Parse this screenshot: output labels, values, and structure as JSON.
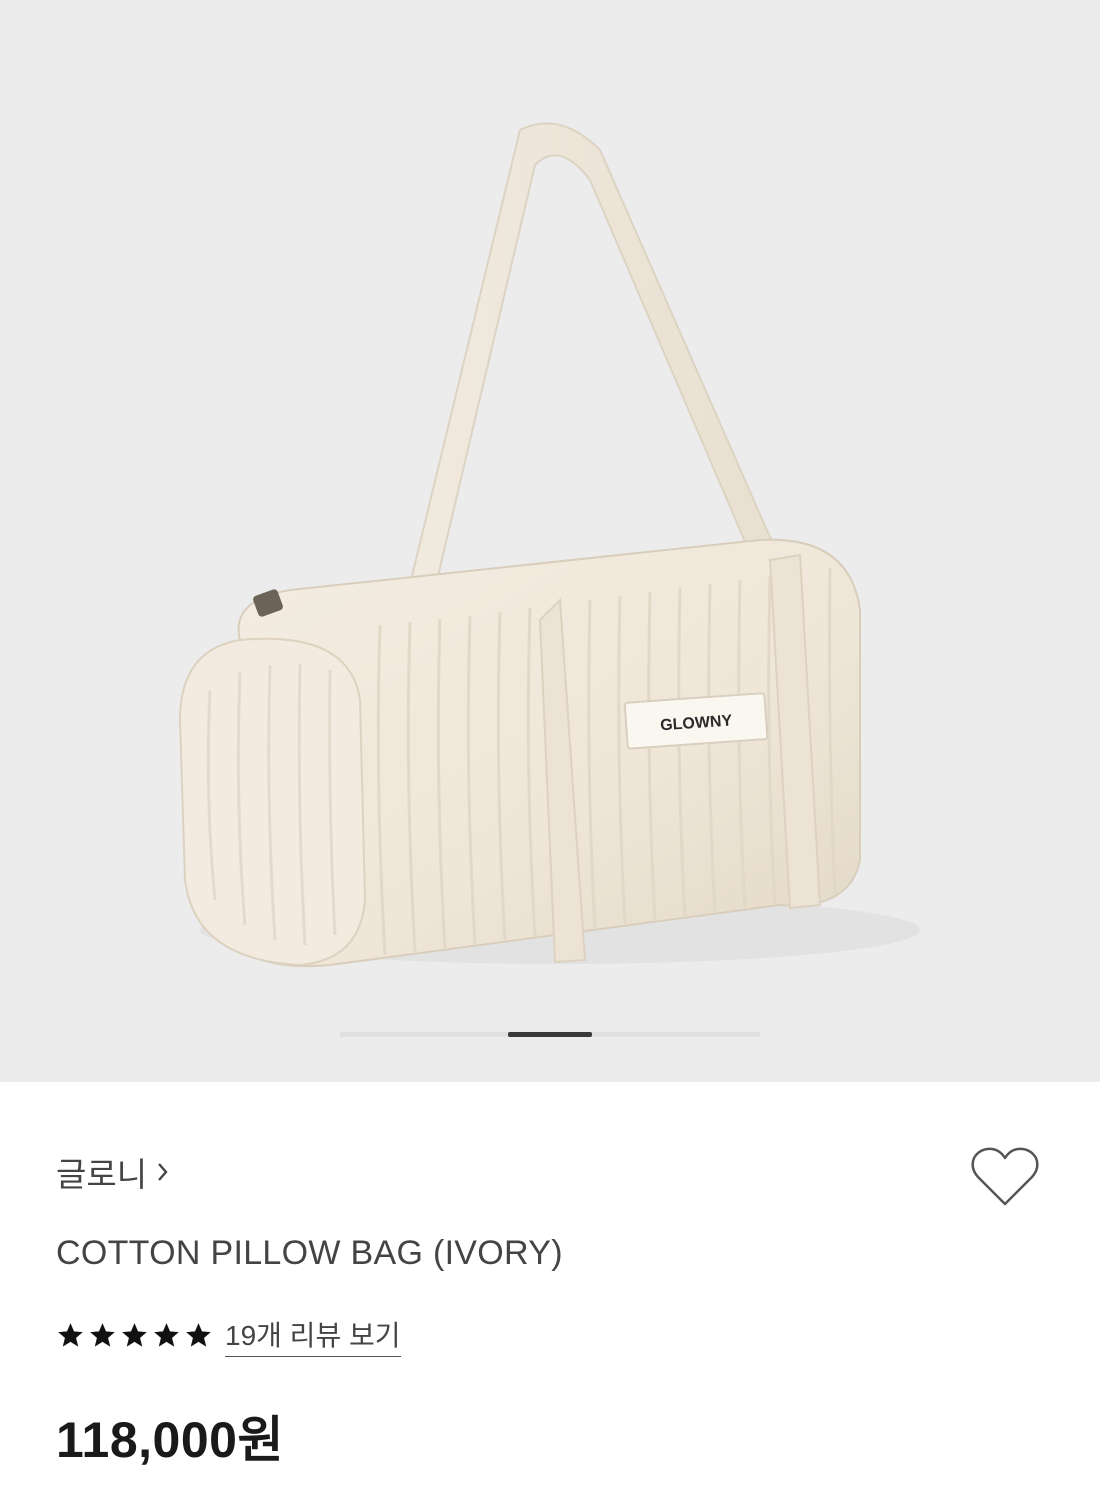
{
  "gallery": {
    "product_label": "GLOWNY",
    "pager": {
      "current": 3,
      "total": 5
    }
  },
  "product": {
    "brand": "글로니",
    "name": "COTTON PILLOW BAG (IVORY)",
    "rating": 5,
    "reviews_link": "19개 리뷰 보기",
    "price": "118,000원"
  },
  "icons": {
    "brand_chevron": "chevron-right-icon",
    "wishlist": "heart-outline-icon",
    "rating": "star-icon"
  },
  "colors": {
    "gallery_bg": "#ececed",
    "bag": "#f1e9dc",
    "text": "#444444",
    "price": "#1a1a1a",
    "pager_active": "#3a3a3a"
  }
}
